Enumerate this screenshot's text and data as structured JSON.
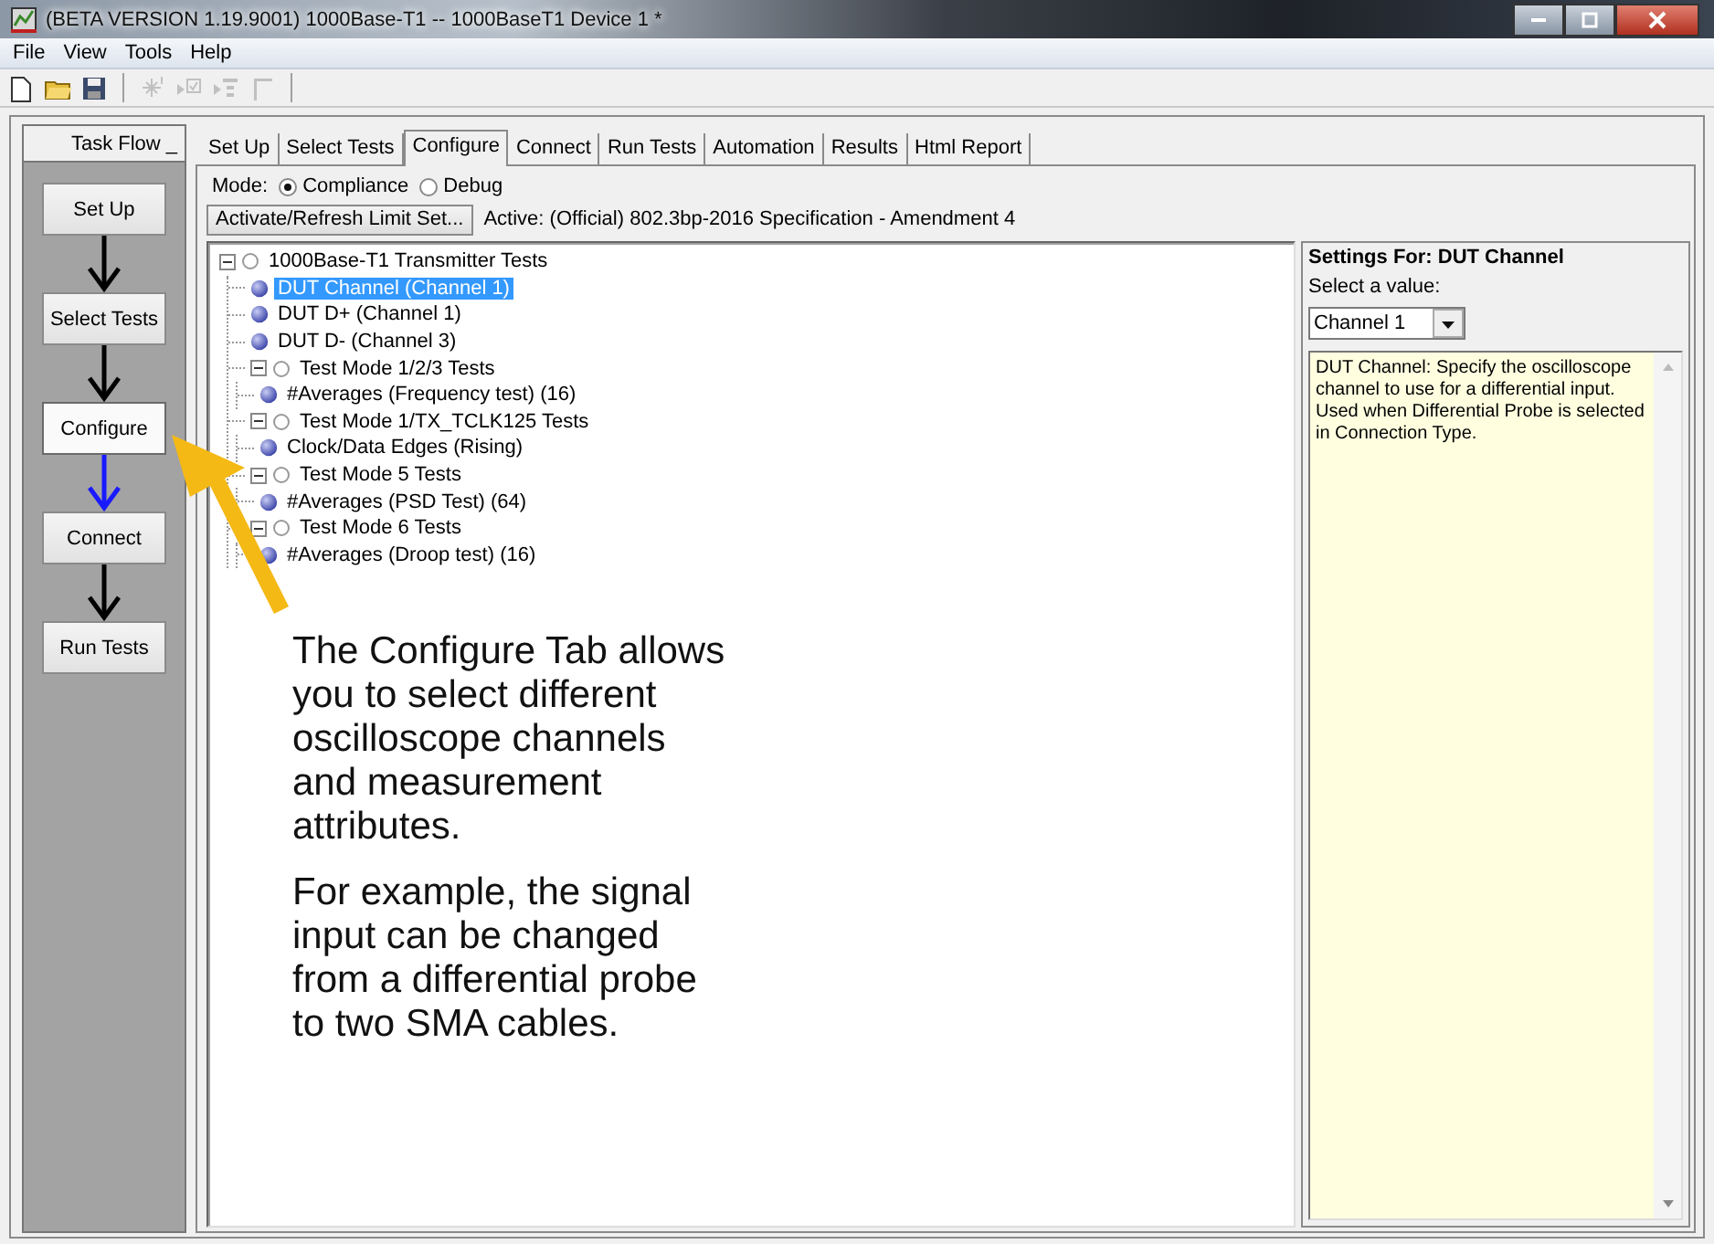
{
  "window": {
    "title": "(BETA VERSION 1.19.9001) 1000Base-T1 -- 1000BaseT1 Device 1 *"
  },
  "menu": [
    "File",
    "View",
    "Tools",
    "Help"
  ],
  "toolbar": [
    {
      "kind": "new",
      "disabled": false
    },
    {
      "kind": "open",
      "disabled": false
    },
    {
      "kind": "save",
      "disabled": false
    },
    {
      "kind": "separator"
    },
    {
      "kind": "run",
      "disabled": true
    },
    {
      "kind": "check",
      "disabled": true
    },
    {
      "kind": "list",
      "disabled": true
    },
    {
      "kind": "bracket",
      "disabled": true
    },
    {
      "kind": "separator"
    }
  ],
  "task_flow": {
    "title": "Task Flow",
    "collapse": "_",
    "steps": [
      {
        "label": "Set Up",
        "selected": false
      },
      {
        "label": "Select Tests",
        "selected": false
      },
      {
        "label": "Configure",
        "selected": true
      },
      {
        "label": "Connect",
        "selected": false
      },
      {
        "label": "Run Tests",
        "selected": false
      }
    ]
  },
  "tabs": [
    {
      "label": "Set Up",
      "selected": false
    },
    {
      "label": "Select Tests",
      "selected": false
    },
    {
      "label": "Configure",
      "selected": true
    },
    {
      "label": "Connect",
      "selected": false
    },
    {
      "label": "Run Tests",
      "selected": false
    },
    {
      "label": "Automation",
      "selected": false
    },
    {
      "label": "Results",
      "selected": false
    },
    {
      "label": "Html Report",
      "selected": false
    }
  ],
  "mode": {
    "label": "Mode:",
    "options": [
      {
        "label": "Compliance",
        "selected": true
      },
      {
        "label": "Debug",
        "selected": false
      }
    ]
  },
  "limit_set": {
    "button": "Activate/Refresh Limit Set...",
    "active": "Active: (Official) 802.3bp-2016 Specification - Amendment 4"
  },
  "tree": [
    {
      "label": "1000Base-T1 Transmitter Tests",
      "kind": "group",
      "expanded": true,
      "selected": false,
      "children": [
        {
          "label": "DUT Channel (Channel 1)",
          "kind": "setting",
          "selected": true
        },
        {
          "label": "DUT D+ (Channel 1)",
          "kind": "setting",
          "selected": false
        },
        {
          "label": "DUT D- (Channel 3)",
          "kind": "setting",
          "selected": false
        },
        {
          "label": "Test Mode 1/2/3 Tests",
          "kind": "group",
          "expanded": true,
          "selected": false,
          "children": [
            {
              "label": "#Averages (Frequency test) (16)",
              "kind": "setting",
              "selected": false
            }
          ]
        },
        {
          "label": "Test Mode 1/TX_TCLK125 Tests",
          "kind": "group",
          "expanded": true,
          "selected": false,
          "children": [
            {
              "label": "Clock/Data Edges (Rising)",
              "kind": "setting",
              "selected": false
            }
          ]
        },
        {
          "label": "Test Mode 5 Tests",
          "kind": "group",
          "expanded": true,
          "selected": false,
          "children": [
            {
              "label": "#Averages (PSD Test) (64)",
              "kind": "setting",
              "selected": false
            }
          ]
        },
        {
          "label": "Test Mode 6 Tests",
          "kind": "group",
          "expanded": true,
          "selected": false,
          "children": [
            {
              "label": "#Averages (Droop test) (16)",
              "kind": "setting",
              "selected": false
            }
          ]
        }
      ]
    }
  ],
  "settings": {
    "title": "Settings For: DUT Channel",
    "prompt": "Select a value:",
    "value": "Channel 1",
    "description": "DUT Channel: Specify the oscilloscope channel to use for a differential input. Used when Differential Probe is selected in Connection Type."
  },
  "callout": {
    "paragraphs": [
      "The Configure Tab allows you to select different oscilloscope channels and measurement attributes.",
      "For example, the signal input can be changed from a differential probe to two SMA cables."
    ]
  }
}
